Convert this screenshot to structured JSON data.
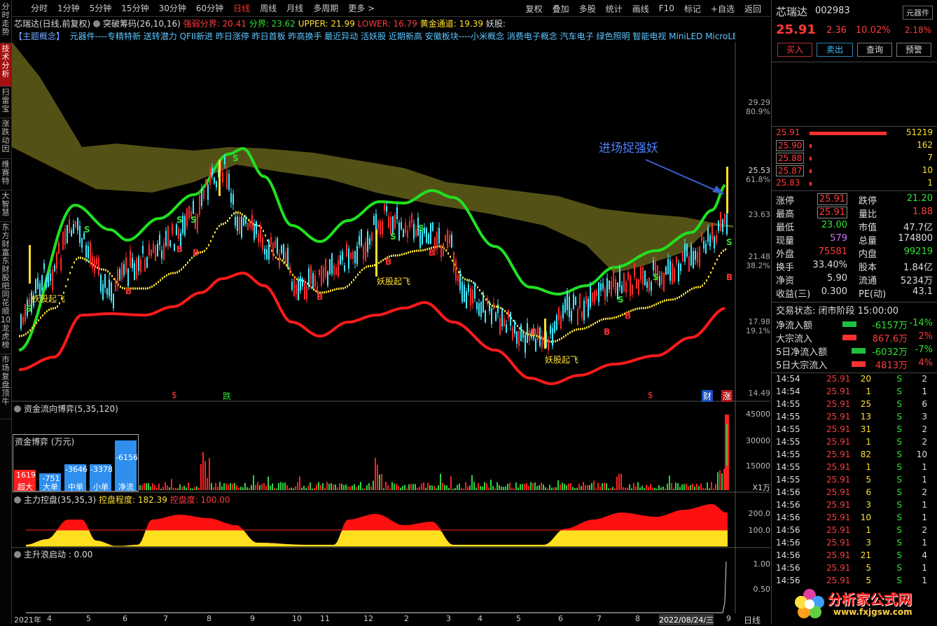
{
  "left_nav": [
    "分时走势",
    "技术分析",
    "扫雷宝",
    "涨跌动因",
    "维赛特",
    "大智慧",
    "东方财富",
    "东财股吧",
    "同花顺10",
    "龙虎榜",
    "市场复盘",
    "顶牛"
  ],
  "toolbar": {
    "periods": [
      "分时",
      "1分钟",
      "5分钟",
      "15分钟",
      "30分钟",
      "60分钟",
      "日线",
      "周线",
      "月线",
      "多周期",
      "更多 >"
    ],
    "active": "日线",
    "right": [
      "复权",
      "叠加",
      "多股",
      "统计",
      "画线",
      "F10",
      "标记",
      "+自选",
      "返回"
    ]
  },
  "info1": {
    "name": "芯瑞达(日线,前复权)",
    "indicator": "突破筹码(26,10,16)",
    "strong": "强弱分界: 20.41",
    "fenjie": "分界: 23.62",
    "upper": "UPPER: 21.99",
    "lower": "LOWER: 16.79",
    "gold": "黄金通道: 19.39",
    "yao": "妖股:"
  },
  "info2": {
    "tag": "【主题概念】",
    "text": "元器件----专精特新 送转潜力 QFII新进 昨日涨停 昨日首板 昨高换手 最近异动 活妖股 近期新高 安徽板块----小米概念 消费电子概念 汽车电子 绿色照明 智能电视 MiniLED MicroLED"
  },
  "main_axis": [
    {
      "v": "29.29",
      "p": "80.9%"
    },
    {
      "v": "25.53",
      "p": "61.8%"
    },
    {
      "v": "23.63",
      "p": ""
    },
    {
      "v": "21.48",
      "p": "38.2%"
    },
    {
      "v": "17.98",
      "p": "19.1%"
    },
    {
      "v": "14.49",
      "p": ""
    }
  ],
  "annot": {
    "arrow_text": "进场捉强妖",
    "yao1": "妖股起飞",
    "yao2": "妖股起飞",
    "yao3": "妖股起飞",
    "die": "跌",
    "cai": "财",
    "zhang": "涨",
    "dollar": "$"
  },
  "panel2": {
    "title": "资金流向博弈(5,35,120)",
    "box_title": "资金博弈 (万元)",
    "vals": [
      "1619",
      "-751",
      "-3646",
      "-3378",
      "-6156"
    ],
    "cats": [
      "超大",
      "大单",
      "中单",
      "小单",
      "净流"
    ],
    "axis": [
      "45000",
      "30000",
      "15000"
    ],
    "unit": "X1万"
  },
  "panel3": {
    "title": "主力控盘(35,35,3)",
    "deg": "控盘程度: 182.39",
    "pan": "控盘度: 100.00",
    "axis": [
      "200.0",
      "100.0"
    ]
  },
  "panel4": {
    "title": "主升浪启动 : 0.00",
    "axis": [
      "1.00",
      "0.50"
    ]
  },
  "xaxis": [
    "2021年",
    "4",
    "5",
    "6",
    "7",
    "8",
    "9",
    "10",
    "11",
    "12",
    "2",
    "3",
    "4",
    "5",
    "6",
    "7",
    "8",
    "2022/08/24/三",
    "9",
    "日线"
  ],
  "right": {
    "name": "芯瑞达",
    "code": "002983",
    "tag": "元器件",
    "price": "25.91",
    "chg": "2.36",
    "pct": "10.02%",
    "pct2": "2.18%",
    "buttons": [
      "买入",
      "卖出",
      "查询",
      "预警"
    ],
    "ask": {
      "price": "25.91",
      "vol": "51219"
    },
    "bids": [
      {
        "p": "25.90",
        "v": "162"
      },
      {
        "p": "25.88",
        "v": "7"
      },
      {
        "p": "25.87",
        "v": "10"
      },
      {
        "p": "25.83",
        "v": "1"
      }
    ],
    "stats": [
      [
        "涨停",
        "25.91",
        "跌停",
        "21.20"
      ],
      [
        "最高",
        "25.91",
        "量比",
        "1.88"
      ],
      [
        "最低",
        "23.00",
        "市值",
        "47.7亿"
      ],
      [
        "现量",
        "579",
        "总量",
        "174800"
      ],
      [
        "外盘",
        "75581",
        "内盘",
        "99219"
      ],
      [
        "换手",
        "33.40%",
        "股本",
        "1.84亿"
      ],
      [
        "净资",
        "5.90",
        "流通",
        "5234万"
      ],
      [
        "收益(三)",
        "0.300",
        "PE(动)",
        "43.1"
      ]
    ],
    "state": "交易状态: 闭市阶段 15:00:00",
    "flows": [
      {
        "l": "净流入额",
        "v": "-6157万",
        "p": "-14%"
      },
      {
        "l": "大宗流入",
        "v": "867.6万",
        "p": "2%"
      },
      {
        "l": "5日净流入额",
        "v": "-6032万",
        "p": "-7%"
      },
      {
        "l": "5日大宗流入",
        "v": "4813万",
        "p": "4%"
      }
    ],
    "ticks": [
      [
        "14:54",
        "25.91",
        "20",
        "S",
        "2"
      ],
      [
        "14:54",
        "25.91",
        "1",
        "S",
        "1"
      ],
      [
        "14:55",
        "25.91",
        "25",
        "S",
        "6"
      ],
      [
        "14:55",
        "25.91",
        "13",
        "S",
        "3"
      ],
      [
        "14:55",
        "25.91",
        "31",
        "S",
        "2"
      ],
      [
        "14:55",
        "25.91",
        "1",
        "S",
        "2"
      ],
      [
        "14:55",
        "25.91",
        "82",
        "S",
        "10"
      ],
      [
        "14:55",
        "25.91",
        "1",
        "S",
        "1"
      ],
      [
        "14:55",
        "25.91",
        "5",
        "S",
        "1"
      ],
      [
        "14:56",
        "25.91",
        "6",
        "S",
        "2"
      ],
      [
        "14:56",
        "25.91",
        "3",
        "S",
        "1"
      ],
      [
        "14:56",
        "25.91",
        "10",
        "S",
        "1"
      ],
      [
        "14:56",
        "25.91",
        "1",
        "S",
        "2"
      ],
      [
        "14:56",
        "25.91",
        "3",
        "S",
        "1"
      ],
      [
        "14:56",
        "25.91",
        "21",
        "S",
        "4"
      ],
      [
        "14:56",
        "25.91",
        "5",
        "S",
        "1"
      ],
      [
        "14:56",
        "25.91",
        "5",
        "S",
        "1"
      ]
    ],
    "watermark": "分析家公式网",
    "watermark_url": "www.fxjgsw.com"
  }
}
